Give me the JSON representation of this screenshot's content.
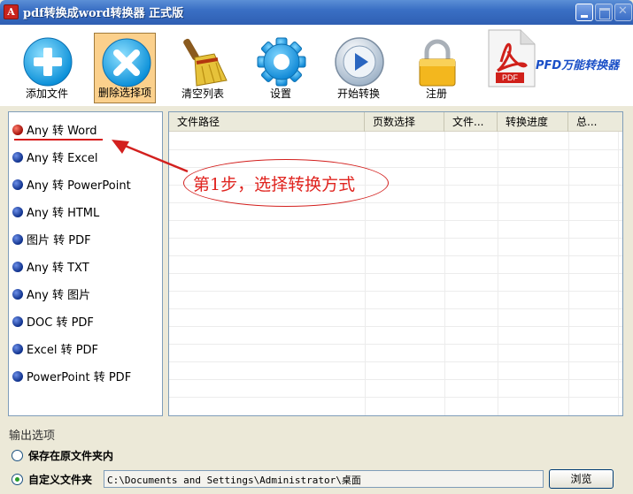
{
  "window": {
    "title": "pdf转换成word转换器 正式版",
    "icon": "acrobat-icon"
  },
  "toolbar": {
    "buttons": [
      {
        "label": "添加文件",
        "icon": "plus-circle-icon"
      },
      {
        "label": "删除选择项",
        "icon": "x-circle-icon",
        "selected": true
      },
      {
        "label": "清空列表",
        "icon": "broom-icon"
      },
      {
        "label": "设置",
        "icon": "gear-icon"
      },
      {
        "label": "开始转换",
        "icon": "play-icon"
      },
      {
        "label": "注册",
        "icon": "lock-icon"
      }
    ],
    "brand": {
      "label": "PFD万能转换器",
      "icon": "pdf-file-icon",
      "pdf_text": "PDF"
    }
  },
  "conversions": [
    {
      "label": "Any 转 Word",
      "active": true
    },
    {
      "label": "Any 转 Excel"
    },
    {
      "label": "Any 转 PowerPoint"
    },
    {
      "label": "Any 转 HTML"
    },
    {
      "label": "图片 转 PDF"
    },
    {
      "label": "Any 转 TXT"
    },
    {
      "label": "Any 转 图片"
    },
    {
      "label": "DOC 转 PDF"
    },
    {
      "label": "Excel 转 PDF"
    },
    {
      "label": "PowerPoint 转 PDF"
    }
  ],
  "table": {
    "columns": [
      "文件路径",
      "页数选择",
      "文件...",
      "转换进度",
      "总..."
    ],
    "rows": []
  },
  "annotation": {
    "text": "第1步，选择转换方式",
    "color": "#e0241f"
  },
  "output": {
    "title": "输出选项",
    "option_same_folder": "保存在原文件夹内",
    "option_custom_folder": "自定义文件夹",
    "custom_folder_selected": true,
    "path": "C:\\Documents and Settings\\Administrator\\桌面",
    "browse_label": "浏览"
  },
  "colors": {
    "accent_selected": "#fbd08c",
    "titlebar": "#3a6fc4",
    "annotation": "#e0241f"
  }
}
